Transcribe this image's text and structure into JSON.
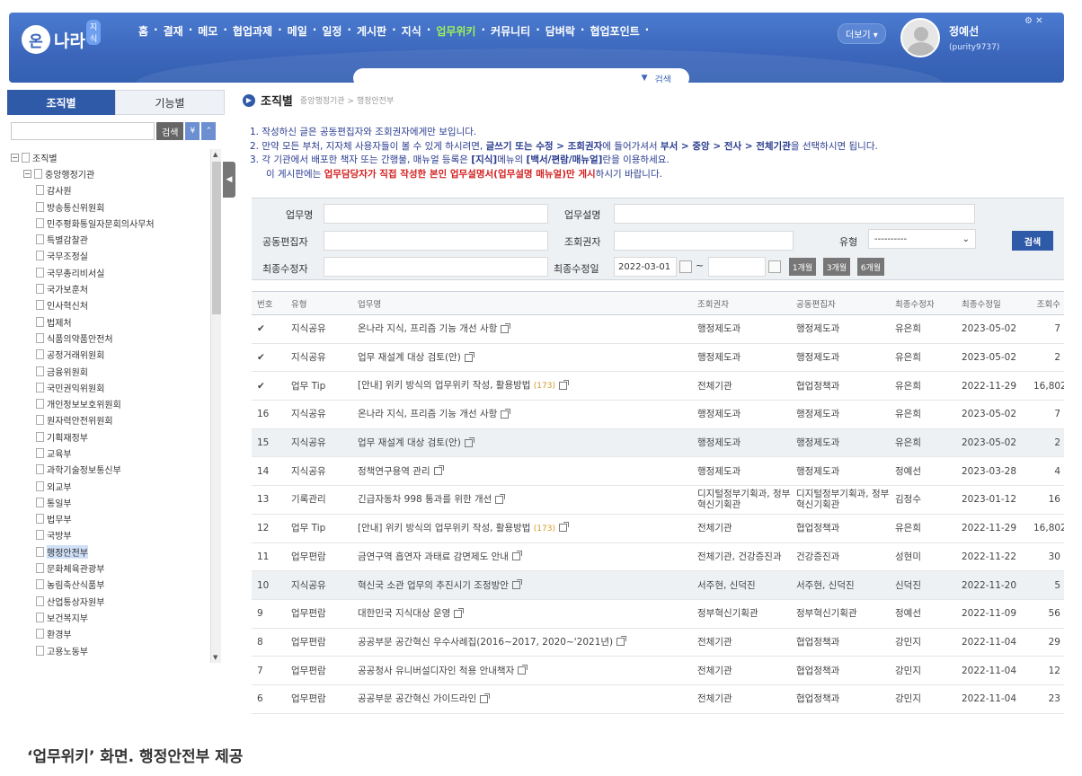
{
  "header": {
    "logo_text": "나라",
    "logo_badge": "지식",
    "nav": [
      "홈",
      "결재",
      "메모",
      "협업과제",
      "메일",
      "일정",
      "게시판",
      "지식",
      "업무위키",
      "커뮤니티",
      "담벼락",
      "협업포인트"
    ],
    "active_nav": "업무위키",
    "more_label": "더보기 ▾",
    "user_name": "정예선",
    "user_id": "(purity9737)",
    "search_label": "검색",
    "accent_color": "#9ff05a"
  },
  "sidebar": {
    "tab_org": "조직별",
    "tab_func": "기능별",
    "search_btn": "검색",
    "tree": [
      {
        "label": "조직별",
        "level": 0,
        "toggle": "−"
      },
      {
        "label": "중앙행정기관",
        "level": 1,
        "toggle": "−"
      },
      {
        "label": "감사원",
        "level": 2
      },
      {
        "label": "방송통신위원회",
        "level": 2
      },
      {
        "label": "민주평화통일자문회의사무처",
        "level": 2
      },
      {
        "label": "특별감찰관",
        "level": 2
      },
      {
        "label": "국무조정실",
        "level": 2
      },
      {
        "label": "국무총리비서실",
        "level": 2
      },
      {
        "label": "국가보훈처",
        "level": 2
      },
      {
        "label": "인사혁신처",
        "level": 2
      },
      {
        "label": "법제처",
        "level": 2
      },
      {
        "label": "식품의약품안전처",
        "level": 2
      },
      {
        "label": "공정거래위원회",
        "level": 2
      },
      {
        "label": "금융위원회",
        "level": 2
      },
      {
        "label": "국민권익위원회",
        "level": 2
      },
      {
        "label": "개인정보보호위원회",
        "level": 2
      },
      {
        "label": "원자력안전위원회",
        "level": 2
      },
      {
        "label": "기획재정부",
        "level": 2
      },
      {
        "label": "교육부",
        "level": 2
      },
      {
        "label": "과학기술정보통신부",
        "level": 2
      },
      {
        "label": "외교부",
        "level": 2
      },
      {
        "label": "통일부",
        "level": 2
      },
      {
        "label": "법무부",
        "level": 2
      },
      {
        "label": "국방부",
        "level": 2
      },
      {
        "label": "행정안전부",
        "level": 2,
        "selected": true
      },
      {
        "label": "문화체육관광부",
        "level": 2
      },
      {
        "label": "농림축산식품부",
        "level": 2
      },
      {
        "label": "산업통상자원부",
        "level": 2
      },
      {
        "label": "보건복지부",
        "level": 2
      },
      {
        "label": "환경부",
        "level": 2
      },
      {
        "label": "고용노동부",
        "level": 2
      }
    ]
  },
  "main": {
    "title": "조직별",
    "path": "중앙행정기관 > 행정안전부",
    "notices": {
      "n1": "1. 작성하신 글은 공동편집자와 조회권자에게만 보입니다.",
      "n2a": "2. 만약 모든 부처, 지자체 사용자들이 볼 수 있게 하시려면, ",
      "n2b": "글쓰기 또는 수정 > 조회권자",
      "n2c": "에 들어가셔서 ",
      "n2d": "부서 > 중앙 > 전사 > 전체기관",
      "n2e": "을 선택하시면 됩니다.",
      "n3a": "3. 각 기관에서 배포한 책자 또는 간행물, 매뉴얼 등록은 ",
      "n3b": "[지식]",
      "n3c": "메뉴의 ",
      "n3d": "[백서/편람/매뉴얼]",
      "n3e": "란을 이용하세요.",
      "n4a": "이 게시판에는 ",
      "n4b": "업무담당자가 직접 작성한 본인 업무설명서(업무설명 매뉴얼)만 게시",
      "n4c": "하시기 바랍니다."
    },
    "filter": {
      "task_name": "업무명",
      "task_desc": "업무설명",
      "co_editor": "공동편집자",
      "viewer": "조회권자",
      "type": "유형",
      "type_value": "----------",
      "last_editor": "최종수정자",
      "last_date": "최종수정일",
      "date_from": "2022-03-01",
      "tilde": "~",
      "btn_1m": "1개월",
      "btn_3m": "3개월",
      "btn_6m": "6개월",
      "search": "검색"
    },
    "columns": [
      "번호",
      "유형",
      "업무명",
      "조회권자",
      "공동편집자",
      "최종수정자",
      "최종수정일",
      "조회수"
    ],
    "rows": [
      {
        "no": "✔",
        "check": true,
        "type": "지식공유",
        "title": "온나라 지식, 프리즘 기능 개선 사항",
        "count": "",
        "viewer": "행정제도과",
        "editor": "행정제도과",
        "modifier": "유은희",
        "date": "2023-05-02",
        "views": "7"
      },
      {
        "no": "✔",
        "check": true,
        "type": "지식공유",
        "title": "업무 재설계 대상 검토(안)",
        "count": "",
        "viewer": "행정제도과",
        "editor": "행정제도과",
        "modifier": "유은희",
        "date": "2023-05-02",
        "views": "2"
      },
      {
        "no": "✔",
        "check": true,
        "type": "업무 Tip",
        "title": "[안내] 위키 방식의 업무위키 작성, 활용방법",
        "count": "(173)",
        "viewer": "전체기관",
        "editor": "협업정책과",
        "modifier": "유은희",
        "date": "2022-11-29",
        "views": "16,802"
      },
      {
        "no": "16",
        "type": "지식공유",
        "title": "온나라 지식, 프리즘 기능 개선 사항",
        "count": "",
        "viewer": "행정제도과",
        "editor": "행정제도과",
        "modifier": "유은희",
        "date": "2023-05-02",
        "views": "7"
      },
      {
        "no": "15",
        "type": "지식공유",
        "title": "업무 재설계 대상 검토(안)",
        "count": "",
        "viewer": "행정제도과",
        "editor": "행정제도과",
        "modifier": "유은희",
        "date": "2023-05-02",
        "views": "2",
        "shade": true
      },
      {
        "no": "14",
        "type": "지식공유",
        "title": "정책연구용역 관리",
        "count": "",
        "viewer": "행정제도과",
        "editor": "행정제도과",
        "modifier": "정예선",
        "date": "2023-03-28",
        "views": "4"
      },
      {
        "no": "13",
        "type": "기록관리",
        "title": "긴급자동차 998 통과를 위한 개선",
        "count": "",
        "viewer": "디지털정부기획과, 정부혁신기획관",
        "editor": "디지털정부기획과, 정부혁신기획관",
        "modifier": "김정수",
        "date": "2023-01-12",
        "views": "16"
      },
      {
        "no": "12",
        "type": "업무 Tip",
        "title": "[안내] 위키 방식의 업무위키 작성, 활용방법",
        "count": "(173)",
        "viewer": "전체기관",
        "editor": "협업정책과",
        "modifier": "유은희",
        "date": "2022-11-29",
        "views": "16,802"
      },
      {
        "no": "11",
        "type": "업무편람",
        "title": "금연구역 흡연자 과태료 감면제도 안내",
        "count": "",
        "viewer": "전체기관, 건강증진과",
        "editor": "건강증진과",
        "modifier": "성현미",
        "date": "2022-11-22",
        "views": "30"
      },
      {
        "no": "10",
        "type": "지식공유",
        "title": "혁신국 소관 업무의 추진시기 조정방안",
        "count": "",
        "viewer": "서주현, 신덕진",
        "editor": "서주현, 신덕진",
        "modifier": "신덕진",
        "date": "2022-11-20",
        "views": "5",
        "shade": true
      },
      {
        "no": "9",
        "type": "업무편람",
        "title": "대한민국 지식대상 운영",
        "count": "",
        "viewer": "정부혁신기획관",
        "editor": "정부혁신기획관",
        "modifier": "정예선",
        "date": "2022-11-09",
        "views": "56"
      },
      {
        "no": "8",
        "type": "업무편람",
        "title": "공공부문 공간혁신 우수사례집(2016~2017, 2020~'2021년)",
        "count": "",
        "viewer": "전체기관",
        "editor": "협업정책과",
        "modifier": "강민지",
        "date": "2022-11-04",
        "views": "29"
      },
      {
        "no": "7",
        "type": "업무편람",
        "title": "공공청사 유니버설디자인 적용 안내책자",
        "count": "",
        "viewer": "전체기관",
        "editor": "협업정책과",
        "modifier": "강민지",
        "date": "2022-11-04",
        "views": "12"
      },
      {
        "no": "6",
        "type": "업무편람",
        "title": "공공부문 공간혁신 가이드라인",
        "count": "",
        "viewer": "전체기관",
        "editor": "협업정책과",
        "modifier": "강민지",
        "date": "2022-11-04",
        "views": "23"
      }
    ]
  },
  "caption": "‘업무위키’ 화면. 행정안전부 제공"
}
